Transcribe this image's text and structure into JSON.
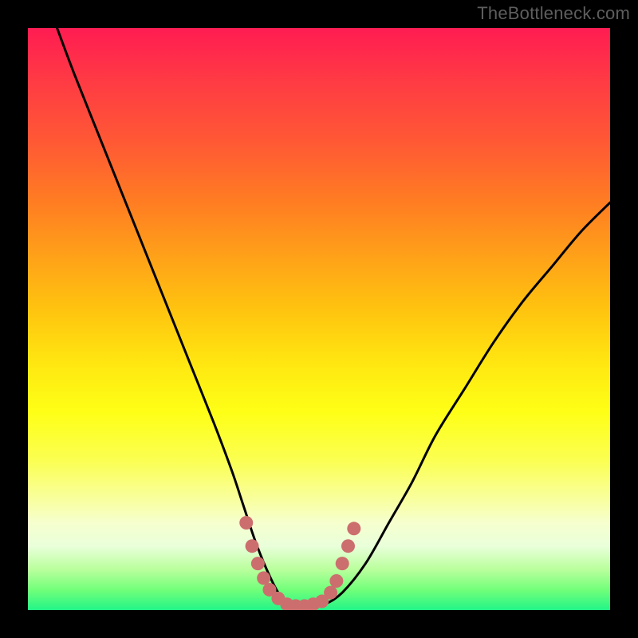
{
  "watermark": {
    "text": "TheBottleneck.com"
  },
  "colors": {
    "curve": "#000000",
    "marker": "#cc6e6e",
    "markerEdge": "#b85f5f"
  },
  "chart_data": {
    "type": "line",
    "title": "",
    "xlabel": "",
    "ylabel": "",
    "xlim": [
      0,
      100
    ],
    "ylim": [
      0,
      100
    ],
    "grid": false,
    "legend": false,
    "series": [
      {
        "name": "bottleneck-curve",
        "x": [
          5,
          8,
          12,
          16,
          20,
          24,
          28,
          32,
          35,
          37,
          39,
          41,
          43,
          45,
          47,
          49,
          51,
          54,
          58,
          62,
          66,
          70,
          75,
          80,
          85,
          90,
          95,
          100
        ],
        "y": [
          100,
          92,
          82,
          72,
          62,
          52,
          42,
          32,
          24,
          18,
          12,
          7,
          3,
          1,
          0.5,
          0.5,
          1,
          3,
          8,
          15,
          22,
          30,
          38,
          46,
          53,
          59,
          65,
          70
        ]
      }
    ],
    "markers": [
      {
        "x": 37.5,
        "y": 15
      },
      {
        "x": 38.5,
        "y": 11
      },
      {
        "x": 39.5,
        "y": 8
      },
      {
        "x": 40.5,
        "y": 5.5
      },
      {
        "x": 41.5,
        "y": 3.5
      },
      {
        "x": 43.0,
        "y": 2
      },
      {
        "x": 44.5,
        "y": 1
      },
      {
        "x": 46.0,
        "y": 0.7
      },
      {
        "x": 47.5,
        "y": 0.7
      },
      {
        "x": 49.0,
        "y": 1
      },
      {
        "x": 50.5,
        "y": 1.5
      },
      {
        "x": 52.0,
        "y": 3
      },
      {
        "x": 53.0,
        "y": 5
      },
      {
        "x": 54.0,
        "y": 8
      },
      {
        "x": 55.0,
        "y": 11
      },
      {
        "x": 56.0,
        "y": 14
      }
    ]
  }
}
